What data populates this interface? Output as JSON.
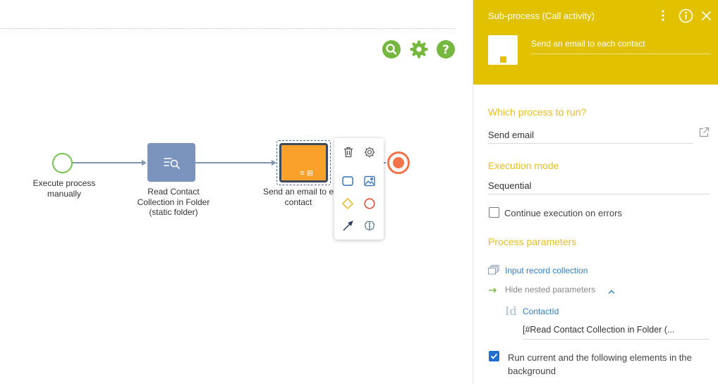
{
  "canvas": {
    "nodes": {
      "start_label": "Execute process manually",
      "read_label": "Read Contact Collection in Folder (static folder)",
      "sub_label": "Send an email to e contact"
    }
  },
  "panel": {
    "title": "Sub-process (Call activity)",
    "element_name": "Send an email to each contact",
    "which_process_label": "Which process to run?",
    "which_process_value": "Send email",
    "execution_mode_label": "Execution mode",
    "execution_mode_value": "Sequential",
    "continue_on_errors_label": "Continue execution on errors",
    "continue_on_errors_checked": false,
    "process_parameters_label": "Process parameters",
    "input_collection_label": "Input record collection",
    "hide_nested_label": "Hide nested parameters",
    "param_type_icon": "Id",
    "param_name": "ContactId",
    "param_value": "[#Read Contact Collection in Folder (...",
    "run_background_label": "Run current and the following elements in the background",
    "run_background_checked": true
  },
  "colors": {
    "panel_header": "#e2c100",
    "section_label": "#e7bf1e",
    "toolbar_green": "#76b83f",
    "subprocess_fill": "#f9a12b",
    "read_node_fill": "#7b94bd",
    "end_event": "#f0734a",
    "start_event": "#76c24f",
    "link": "#2f7fc6",
    "checkbox_checked": "#1f6fd1"
  },
  "icons": {
    "toolbar": [
      "search-icon",
      "gear-icon",
      "help-icon"
    ],
    "context_menu": [
      "trash-icon",
      "settings-icon",
      "task-icon",
      "image-icon",
      "gateway-icon",
      "event-icon",
      "connector-icon",
      "brain-icon"
    ],
    "panel_header": [
      "more-vertical-icon",
      "info-icon",
      "close-icon"
    ]
  }
}
